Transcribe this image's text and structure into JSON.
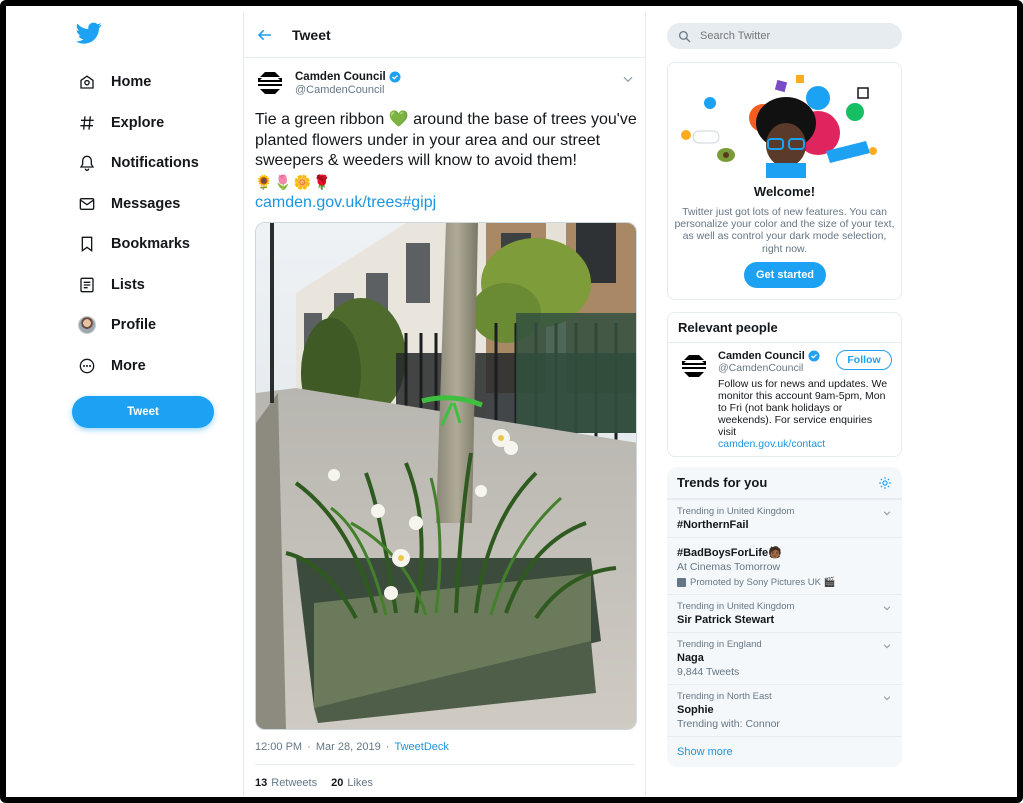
{
  "colors": {
    "accent": "#1da1f2",
    "link": "#1b95e0",
    "text": "#14171a",
    "muted": "#657786",
    "border": "#e6ecf0"
  },
  "nav": {
    "logo_icon": "twitter-bird-icon",
    "items": [
      {
        "label": "Home",
        "icon": "home-icon"
      },
      {
        "label": "Explore",
        "icon": "hashtag-icon"
      },
      {
        "label": "Notifications",
        "icon": "bell-icon"
      },
      {
        "label": "Messages",
        "icon": "envelope-icon"
      },
      {
        "label": "Bookmarks",
        "icon": "bookmark-icon"
      },
      {
        "label": "Lists",
        "icon": "list-icon"
      },
      {
        "label": "Profile",
        "icon": "avatar"
      },
      {
        "label": "More",
        "icon": "more-icon"
      }
    ],
    "tweet_button": "Tweet"
  },
  "center": {
    "header_title": "Tweet",
    "tweet": {
      "author_name": "Camden Council",
      "author_handle": "@CamdenCouncil",
      "text": "Tie a green ribbon 💚 around the base of trees you've planted flowers under in your area and our street sweepers & weeders will know to avoid them!",
      "emojis": "🌻🌷🌼🌹",
      "link": "camden.gov.uk/trees#gipj",
      "time": "12:00 PM",
      "date": "Mar 28, 2019",
      "via": "TweetDeck",
      "retweets": "13",
      "retweets_label": "Retweets",
      "likes": "20",
      "likes_label": "Likes"
    }
  },
  "right": {
    "search_placeholder": "Search Twitter",
    "welcome": {
      "title": "Welcome!",
      "body": "Twitter just got lots of new features. You can personalize your color and the size of your text, as well as control your dark mode selection, right now.",
      "button": "Get started"
    },
    "relevant": {
      "heading": "Relevant people",
      "name": "Camden Council",
      "handle": "@CamdenCouncil",
      "follow": "Follow",
      "bio": "Follow us for news and updates. We monitor this account 9am-5pm, Mon to Fri (not bank holidays or weekends). For service enquiries visit",
      "bio_link": "camden.gov.uk/contact"
    },
    "trends": {
      "heading": "Trends for you",
      "items": [
        {
          "context": "Trending in United Kingdom",
          "name": "#NorthernFail"
        },
        {
          "name": "#BadBoysForLife🧑🏾",
          "sub": "At Cinemas Tomorrow",
          "promo": "Promoted by Sony Pictures UK 🎬"
        },
        {
          "context": "Trending in United Kingdom",
          "name": "Sir Patrick Stewart"
        },
        {
          "context": "Trending in England",
          "name": "Naga",
          "sub": "9,844 Tweets"
        },
        {
          "context": "Trending in North East",
          "name": "Sophie",
          "sub": "Trending with: Connor"
        }
      ],
      "show_more": "Show more"
    }
  }
}
